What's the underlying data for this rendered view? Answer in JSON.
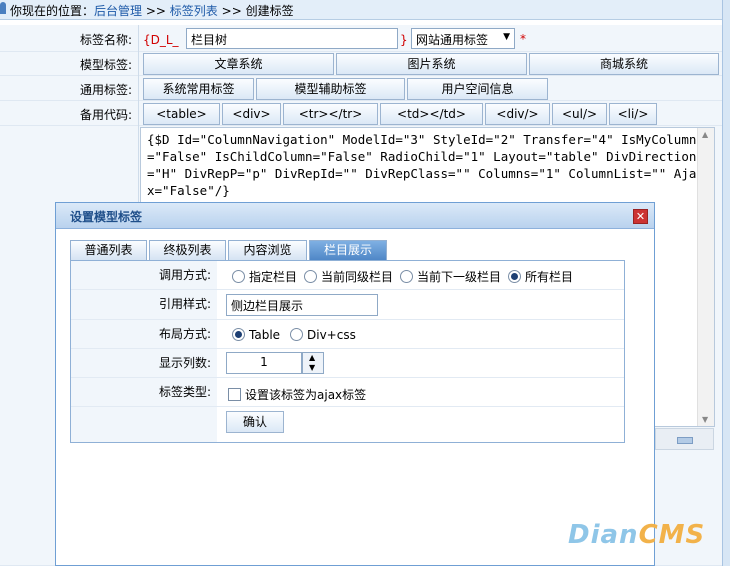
{
  "breadcrumb": {
    "prefix": "你现在的位置：",
    "items": [
      "后台管理",
      "标签列表",
      "创建标签"
    ],
    "separator": ">>"
  },
  "form": {
    "tag_name": {
      "label": "标签名称:",
      "prefix": "{D_L_",
      "value": "栏目树",
      "suffix": "}",
      "type_select": "网站通用标签",
      "required_mark": "*"
    },
    "model_tags": {
      "label": "模型标签:",
      "buttons": [
        "文章系统",
        "图片系统",
        "商城系统"
      ]
    },
    "common_tags": {
      "label": "通用标签:",
      "buttons": [
        "系统常用标签",
        "模型辅助标签",
        "用户空间信息"
      ]
    },
    "backup_code": {
      "label": "备用代码:",
      "buttons": [
        "<table>",
        "<div>",
        "<tr></tr>",
        "<td></td>",
        "<div/>",
        "<ul/>",
        "<li/>"
      ]
    },
    "code": "{$D Id=\"ColumnNavigation\" ModelId=\"3\" StyleId=\"2\" Transfer=\"4\" IsMyColumn=\"False\" IsChildColumn=\"False\" RadioChild=\"1\" Layout=\"table\" DivDirection=\"H\" DivRepP=\"p\" DivRepId=\"\" DivRepClass=\"\" Columns=\"1\" ColumnList=\"\" Ajax=\"False\"/}"
  },
  "dialog": {
    "title": "设置模型标签",
    "close": "✕",
    "tabs": [
      "普通列表",
      "终极列表",
      "内容浏览",
      "栏目展示"
    ],
    "active_tab": "栏目展示",
    "call_mode": {
      "label": "调用方式:",
      "options": [
        "指定栏目",
        "当前同级栏目",
        "当前下一级栏目",
        "所有栏目"
      ],
      "selected": "所有栏目"
    },
    "style": {
      "label": "引用样式:",
      "value": "侧边栏目展示"
    },
    "layout": {
      "label": "布局方式:",
      "options": [
        "Table",
        "Div+css"
      ],
      "selected": "Table"
    },
    "columns": {
      "label": "显示列数:",
      "value": "1"
    },
    "tag_type": {
      "label": "标签类型:",
      "checkbox_label": "设置该标签为ajax标签",
      "checked": false
    },
    "confirm": "确认"
  },
  "logo": {
    "part1": "Dian",
    "part2": "CMS"
  },
  "colors": {
    "accent": "#4f87c7",
    "required": "#d10000",
    "label_bg": "#f1f6fb"
  }
}
